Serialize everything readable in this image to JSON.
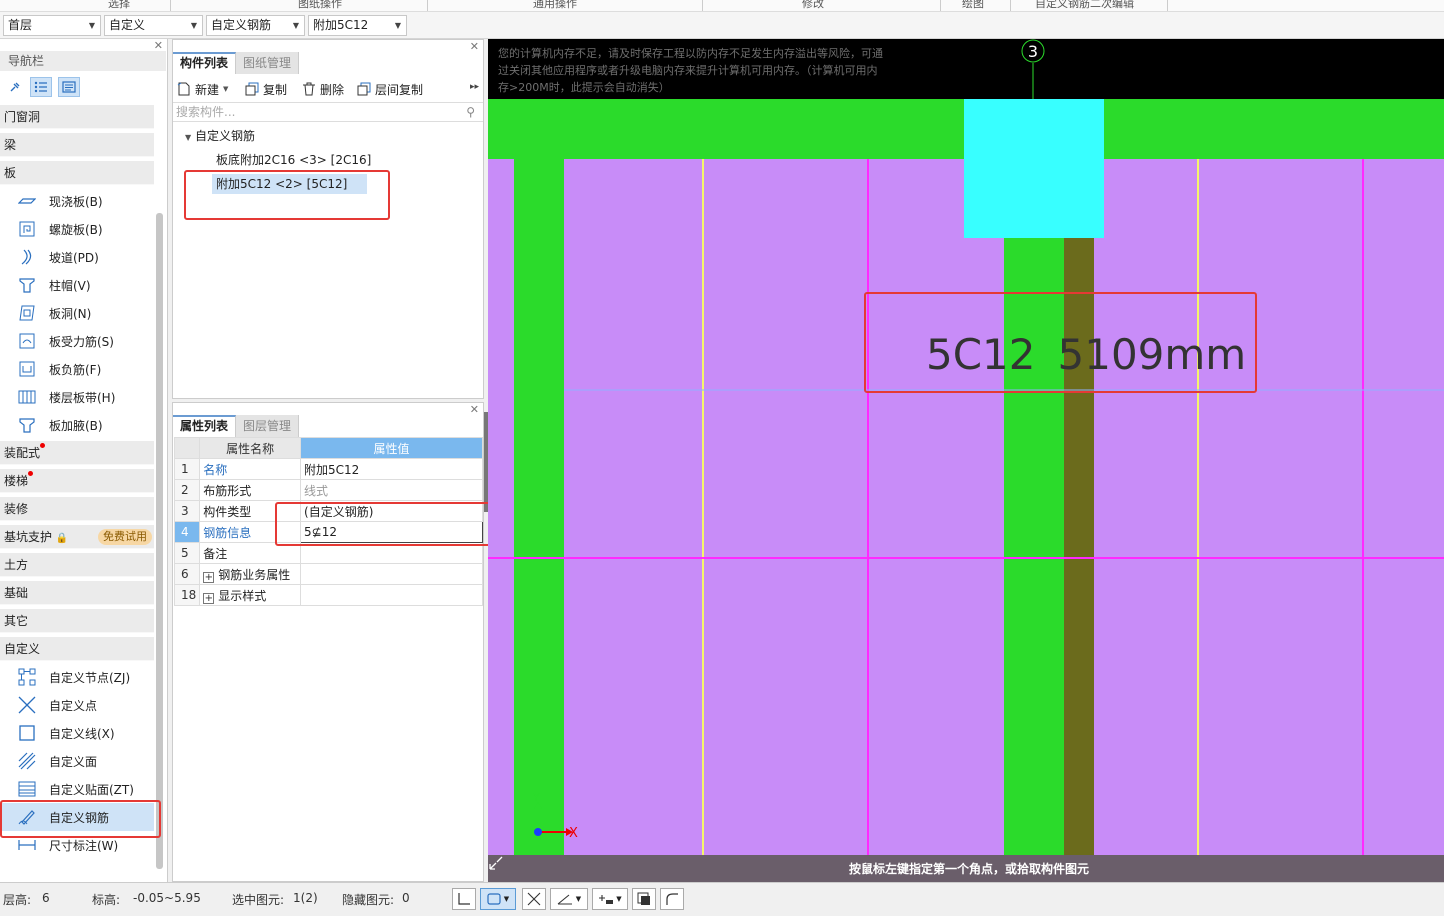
{
  "menu": {
    "items": [
      "选择",
      "图纸操作",
      "通用操作",
      "修改",
      "绘图",
      "自定义钢筋二次编辑"
    ]
  },
  "selectors": {
    "floor": "首层",
    "category": "自定义",
    "type": "自定义钢筋",
    "component": "附加5C12"
  },
  "nav": {
    "title": "导航栏",
    "categories": {
      "door": "门窗洞",
      "beam": "梁",
      "slab": "板",
      "assembly": "装配式",
      "stair": "楼梯",
      "decor": "装修",
      "pit": "基坑支护",
      "pit_badge": "免费试用",
      "earth": "土方",
      "foundation": "基础",
      "other": "其它",
      "custom": "自定义"
    },
    "slab_items": [
      "现浇板(B)",
      "螺旋板(B)",
      "坡道(PD)",
      "柱帽(V)",
      "板洞(N)",
      "板受力筋(S)",
      "板负筋(F)",
      "楼层板带(H)",
      "板加腋(B)"
    ],
    "custom_items": [
      "自定义节点(ZJ)",
      "自定义点",
      "自定义线(X)",
      "自定义面",
      "自定义贴面(ZT)",
      "自定义钢筋",
      "尺寸标注(W)"
    ]
  },
  "component_list": {
    "tab_active": "构件列表",
    "tab_other": "图纸管理",
    "tools": {
      "new": "新建",
      "copy": "复制",
      "delete": "删除",
      "floor_copy": "层间复制"
    },
    "search_placeholder": "搜索构件...",
    "tree": {
      "root": "自定义钢筋",
      "children": [
        "板底附加2C16 <3> [2C16]",
        "附加5C12 <2> [5C12]"
      ]
    }
  },
  "properties": {
    "tab_active": "属性列表",
    "tab_other": "图层管理",
    "header": {
      "name": "属性名称",
      "value": "属性值"
    },
    "rows": [
      {
        "num": "1",
        "name": "名称",
        "value": "附加5C12"
      },
      {
        "num": "2",
        "name": "布筋形式",
        "value": "线式"
      },
      {
        "num": "3",
        "name": "构件类型",
        "value": "(自定义钢筋)"
      },
      {
        "num": "4",
        "name": "钢筋信息",
        "value": "5⊈12"
      },
      {
        "num": "5",
        "name": "备注",
        "value": ""
      },
      {
        "num": "6",
        "name": "钢筋业务属性",
        "value": ""
      },
      {
        "num": "18",
        "name": "显示样式",
        "value": ""
      }
    ]
  },
  "canvas": {
    "memory_warning": "您的计算机内存不足，请及时保存工程以防内存不足发生内存溢出等风险，可通过关闭其他应用程序或者升级电脑内存来提升计算机可用内存。（计算机可用内存>200M时，此提示会自动消失）",
    "axis_label": "3",
    "rebar_label_a": "5C12",
    "rebar_label_b": "5109mm",
    "axis_x": "X",
    "axis_y": "Y",
    "hint": "按鼠标左键指定第一个角点，或拾取构件图元",
    "colors": {
      "slab": "#c88cf8",
      "beam": "#2bdb2b",
      "column": "#38ffff",
      "rebar": "#6b6b1c",
      "grid_magenta": "#ff29ff",
      "grid_yellow": "#f5f56a"
    }
  },
  "status": {
    "floor_height_label": "层高:",
    "floor_height": "6",
    "elevation_label": "标高:",
    "elevation": "-0.05~5.95",
    "selected_label": "选中图元:",
    "selected": "1(2)",
    "hidden_label": "隐藏图元:",
    "hidden": "0"
  }
}
